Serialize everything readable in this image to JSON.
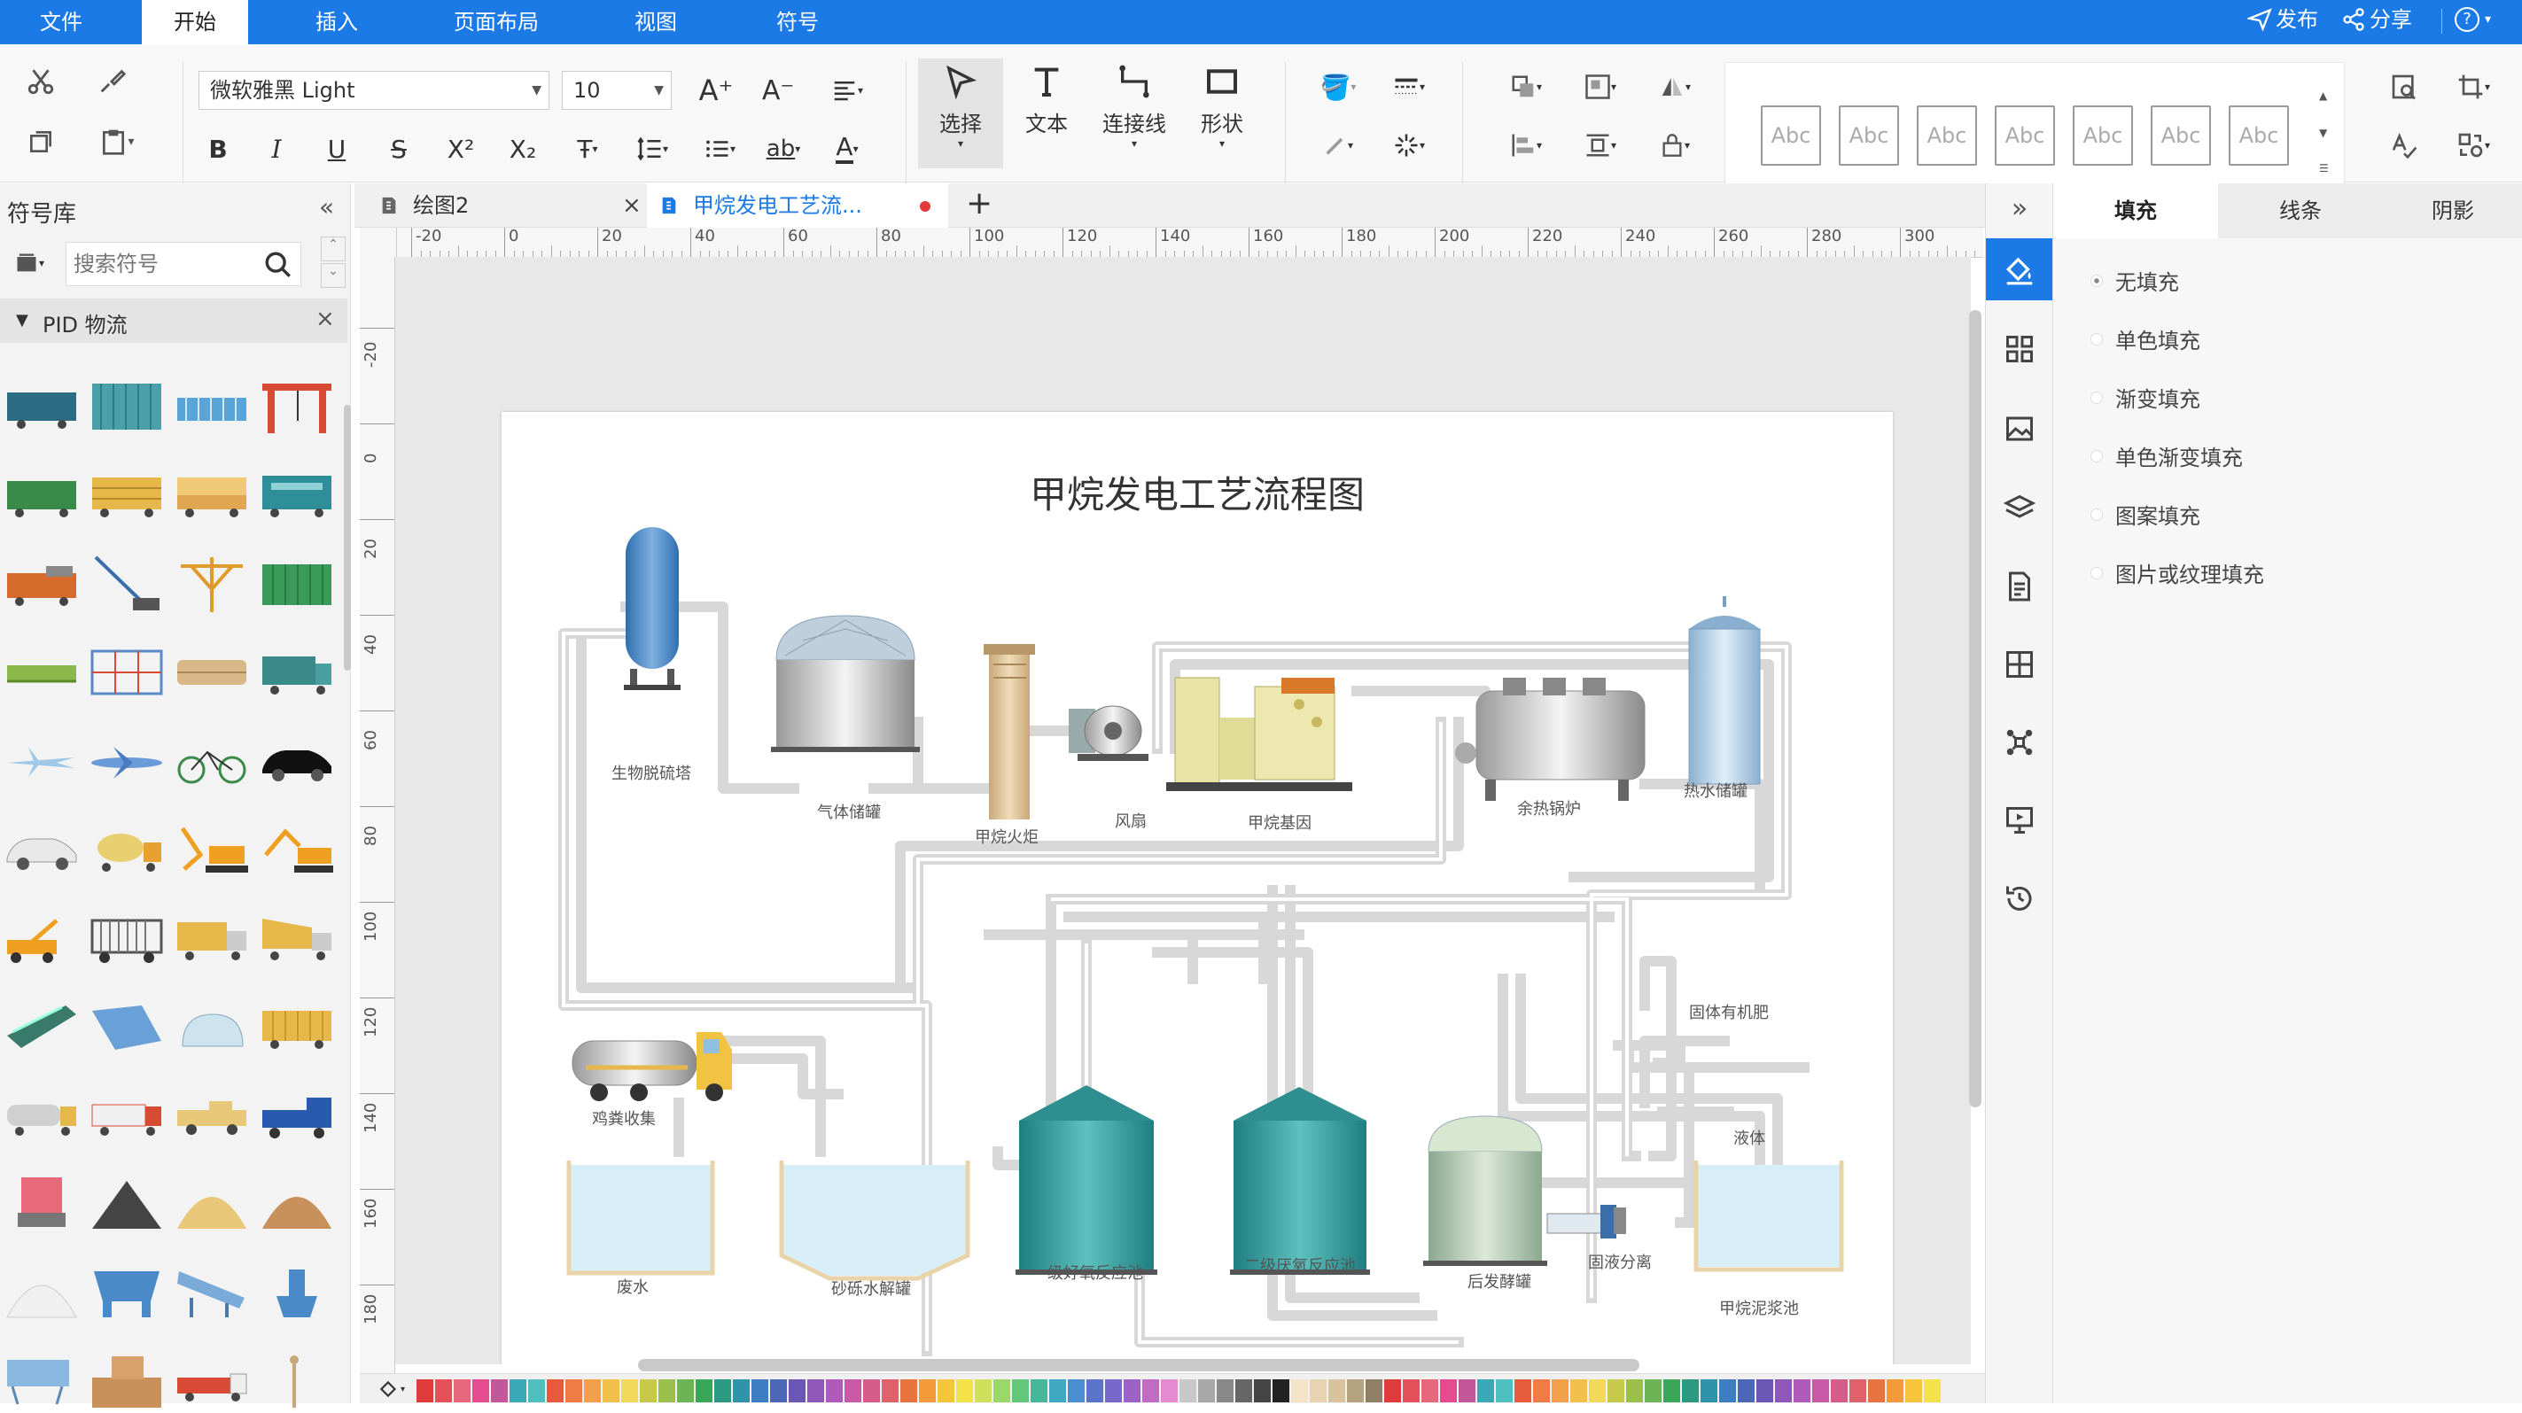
{
  "menu": {
    "tabs": [
      "文件",
      "开始",
      "插入",
      "页面布局",
      "视图",
      "符号"
    ],
    "active_tab": "开始",
    "publish": "发布",
    "share": "分享",
    "help": "?"
  },
  "ribbon": {
    "font_name": "微软雅黑 Light",
    "font_size": "10",
    "select_label": "选择",
    "text_label": "文本",
    "connector_label": "连接线",
    "shape_label": "形状",
    "style_preview_text": "Abc"
  },
  "left_panel": {
    "title": "符号库",
    "search_placeholder": "搜索符号",
    "category": "PID 物流"
  },
  "doc_tabs": [
    {
      "label": "绘图2"
    },
    {
      "label": "甲烷发电工艺流..."
    }
  ],
  "ruler": {
    "h_ticks": [
      "-20",
      "0",
      "20",
      "40",
      "60",
      "80",
      "100",
      "120",
      "140",
      "160",
      "180",
      "200",
      "220",
      "240",
      "260",
      "280",
      "300"
    ],
    "v_ticks": [
      "-20",
      "0",
      "20",
      "40",
      "60",
      "80",
      "100",
      "120",
      "140",
      "160",
      "180"
    ]
  },
  "diagram": {
    "title": "甲烷发电工艺流程图",
    "labels": {
      "desulfurizer": "生物脱硫塔",
      "gas_tank": "气体储罐",
      "flare": "甲烷火炬",
      "fan": "风扇",
      "generator": "甲烷基因",
      "boiler": "余热锅炉",
      "hot_water": "热水储罐",
      "manure": "鸡粪收集",
      "wastewater": "废水",
      "hydrolysis": "砂砾水解罐",
      "aerobic": "一级好氧反应池",
      "anaerobic": "二级厌氧反应池",
      "post_ferment": "后发酵罐",
      "solid_liquid": "固液分离",
      "solid_fertilizer": "固体有机肥",
      "liquid": "液体",
      "slurry_pool": "甲烷泥浆池"
    },
    "colors": {
      "pipe": "#dcdcdc",
      "blue_tank": "#3f7fc0",
      "teal_tank": "#2a9a9a",
      "water": "#d6ecf8"
    }
  },
  "right_panel": {
    "tabs": [
      "填充",
      "线条",
      "阴影"
    ],
    "active_tab": "填充",
    "fill_options": [
      "无填充",
      "单色填充",
      "渐变填充",
      "单色渐变填充",
      "图案填充",
      "图片或纹理填充"
    ]
  },
  "palette": [
    "#e03b3b",
    "#e6505a",
    "#e7677c",
    "#e54c8f",
    "#c2579a",
    "#39a9b8",
    "#4fc0c0",
    "#e75b3d",
    "#ef7c45",
    "#f2a04a",
    "#f0c04b",
    "#f2d95c",
    "#c7c94b",
    "#9ac04b",
    "#6cb455",
    "#3aa65a",
    "#2c9a83",
    "#2f93a9",
    "#3d7dc2",
    "#4a67b8",
    "#6a57b5",
    "#8f58b8",
    "#b05ab9",
    "#c95aa8",
    "#d65c8a",
    "#e0606c",
    "#e8733f",
    "#f39a3a",
    "#f6c53c",
    "#f3e24a",
    "#cfe05a",
    "#9bd86a",
    "#63c87a",
    "#45b89a",
    "#3fa9c2",
    "#4a8dd0",
    "#5a74c9",
    "#7868c9",
    "#9c62c6",
    "#c26bc2",
    "#e48ad0",
    "#c8c8c8",
    "#a8a8a8",
    "#888888",
    "#666666",
    "#444444",
    "#222222",
    "#f4e3c8",
    "#e8d3b0",
    "#d9c39e",
    "#b5a27f",
    "#8f7f64"
  ]
}
